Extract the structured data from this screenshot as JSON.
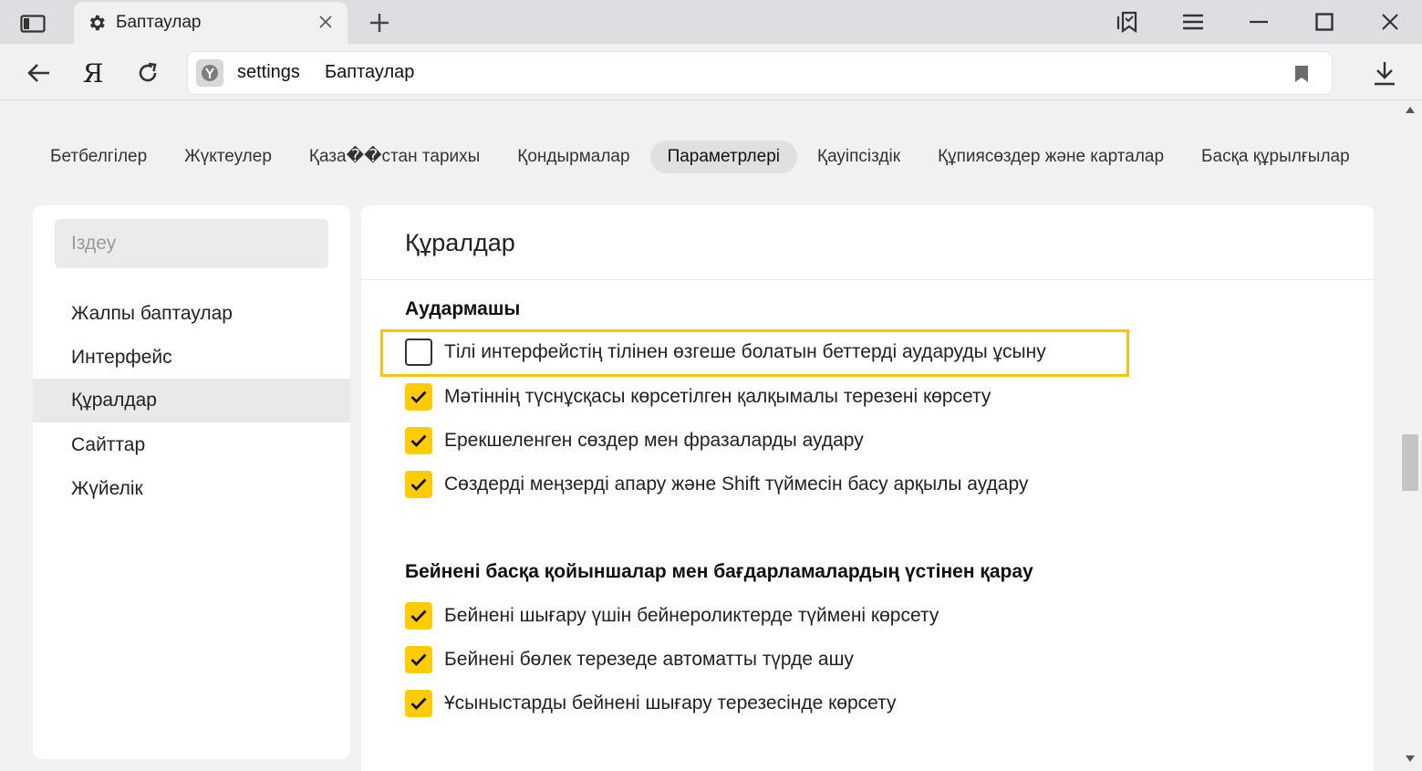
{
  "browser": {
    "tab": {
      "title": "Баптаулар",
      "icon": "gear-icon"
    },
    "address": {
      "url": "settings",
      "page_title": "Баптаулар"
    },
    "logo_text": "Я"
  },
  "settings_nav": [
    {
      "label": "Бетбелгілер",
      "active": false
    },
    {
      "label": "Жүктеулер",
      "active": false
    },
    {
      "label": "Қаза��стан тарихы",
      "active": false
    },
    {
      "label": "Қондырмалар",
      "active": false
    },
    {
      "label": "Параметрлері",
      "active": true
    },
    {
      "label": "Қауіпсіздік",
      "active": false
    },
    {
      "label": "Құпиясөздер және карталар",
      "active": false
    },
    {
      "label": "Басқа құрылғылар",
      "active": false
    }
  ],
  "sidebar": {
    "search_placeholder": "Іздеу",
    "items": [
      {
        "label": "Жалпы баптаулар",
        "active": false
      },
      {
        "label": "Интерфейс",
        "active": false
      },
      {
        "label": "Құралдар",
        "active": true
      },
      {
        "label": "Сайттар",
        "active": false
      },
      {
        "label": "Жүйелік",
        "active": false
      }
    ]
  },
  "main": {
    "title": "Құралдар",
    "sections": [
      {
        "title": "Аудармашы",
        "options": [
          {
            "label": "Тілі интерфейстің тілінен өзгеше болатын беттерді аударуды ұсыну",
            "checked": false,
            "highlighted": true
          },
          {
            "label": "Мәтіннің түснұсқасы көрсетілген қалқымалы терезені көрсету",
            "checked": true
          },
          {
            "label": "Ерекшеленген сөздер мен фразаларды аудару",
            "checked": true
          },
          {
            "label": "Сөздерді меңзерді апару және Shift түймесін басу арқылы аудару",
            "checked": true
          }
        ]
      },
      {
        "title": "Бейнені басқа қойыншалар мен бағдарламалардың үстінен қарау",
        "options": [
          {
            "label": "Бейнені шығару үшін бейнероликтерде түймені көрсету",
            "checked": true
          },
          {
            "label": "Бейнені бөлек терезеде автоматты түрде ашу",
            "checked": true
          },
          {
            "label": "Ұсыныстарды бейнені шығару терезесінде көрсету",
            "checked": true
          }
        ]
      }
    ]
  },
  "colors": {
    "accent_checkbox": "#ffcc00",
    "highlight_border": "#f2c511",
    "tabbar_bg": "#dedee2",
    "page_bg": "#f2f1f0"
  }
}
